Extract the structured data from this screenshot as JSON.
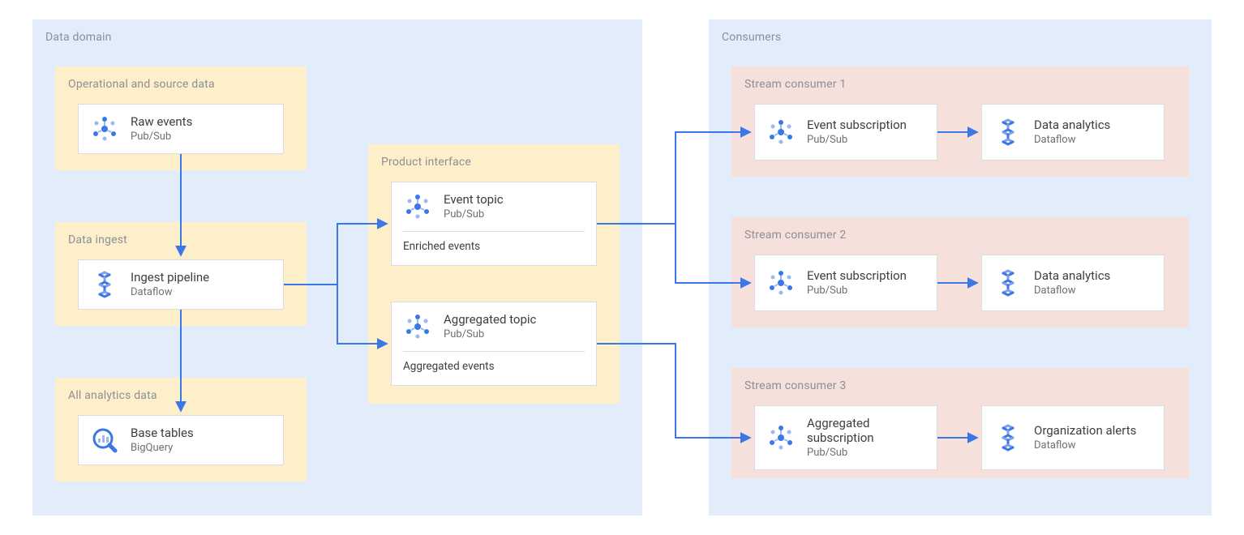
{
  "domain": {
    "label": "Data domain",
    "source": {
      "label": "Operational and source data",
      "raw": {
        "title": "Raw events",
        "sub": "Pub/Sub",
        "icon": "pubsub"
      }
    },
    "ingest": {
      "label": "Data ingest",
      "pipeline": {
        "title": "Ingest pipeline",
        "sub": "Dataflow",
        "icon": "dataflow"
      }
    },
    "analytics": {
      "label": "All analytics data",
      "tables": {
        "title": "Base tables",
        "sub": "BigQuery",
        "icon": "bigquery"
      }
    },
    "product": {
      "label": "Product interface",
      "event_topic": {
        "title": "Event topic",
        "sub": "Pub/Sub",
        "note": "Enriched events",
        "icon": "pubsub"
      },
      "agg_topic": {
        "title": "Aggregated topic",
        "sub": "Pub/Sub",
        "note": "Aggregated events",
        "icon": "pubsub"
      }
    }
  },
  "consumers": {
    "label": "Consumers",
    "c1": {
      "label": "Stream consumer 1",
      "sub": {
        "title": "Event subscription",
        "sub": "Pub/Sub",
        "icon": "pubsub"
      },
      "proc": {
        "title": "Data analytics",
        "sub": "Dataflow",
        "icon": "dataflow"
      }
    },
    "c2": {
      "label": "Stream consumer 2",
      "sub": {
        "title": "Event subscription",
        "sub": "Pub/Sub",
        "icon": "pubsub"
      },
      "proc": {
        "title": "Data analytics",
        "sub": "Dataflow",
        "icon": "dataflow"
      }
    },
    "c3": {
      "label": "Stream consumer 3",
      "sub": {
        "title": "Aggregated subscription",
        "sub": "Pub/Sub",
        "icon": "pubsub"
      },
      "proc": {
        "title": "Organization alerts",
        "sub": "Dataflow",
        "icon": "dataflow"
      }
    }
  }
}
